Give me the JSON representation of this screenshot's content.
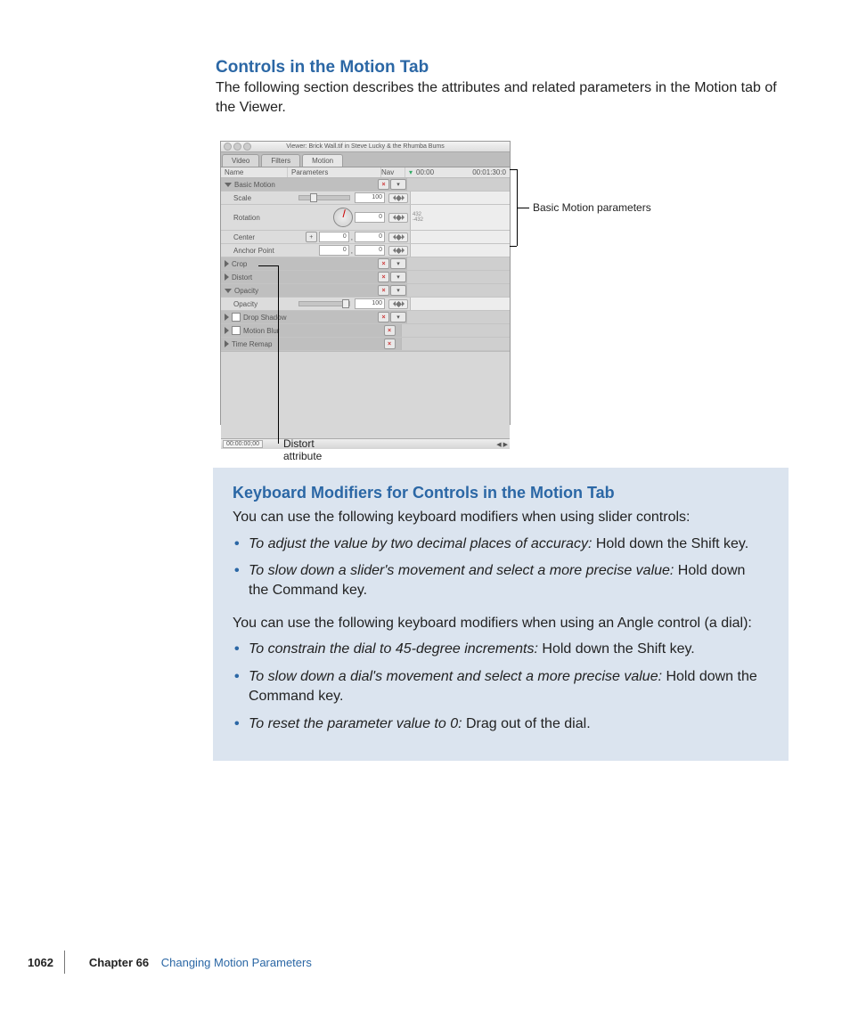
{
  "headings": {
    "controls": "Controls in the Motion Tab",
    "keyboard": "Keyboard Modifiers for Controls in the Motion Tab"
  },
  "intro": "The following section describes the attributes and related parameters in the Motion tab of the Viewer.",
  "screenshot": {
    "window_title": "Viewer: Brick Wall.tif in Steve Lucky & the Rhumba Bums",
    "tabs": {
      "video": "Video",
      "filters": "Filters",
      "motion": "Motion"
    },
    "columns": {
      "name": "Name",
      "parameters": "Parameters",
      "nav": "Nav"
    },
    "timecode_right": "00:01:30:0",
    "timecode_left": "00:00:00;00",
    "rows": {
      "basic_motion": "Basic Motion",
      "scale": "Scale",
      "scale_value": "100",
      "rotation": "Rotation",
      "rotation_value": "0",
      "rotation_track_a": "432",
      "rotation_track_b": "-432",
      "center": "Center",
      "center_x": "0",
      "center_y": "0",
      "anchor_point": "Anchor Point",
      "anchor_x": "0",
      "anchor_y": "0",
      "crop": "Crop",
      "distort": "Distort",
      "opacity_group": "Opacity",
      "opacity": "Opacity",
      "opacity_value": "100",
      "drop_shadow": "Drop Shadow",
      "motion_blur": "Motion Blur",
      "time_remap": "Time Remap"
    }
  },
  "callouts": {
    "basic_motion": "Basic Motion parameters",
    "distort": "Distort attribute"
  },
  "keyboard": {
    "intro_sliders": "You can use the following keyboard modifiers when using slider controls:",
    "slider_items": [
      {
        "em": "To adjust the value by two decimal places of accuracy:",
        "rest": "  Hold down the Shift key."
      },
      {
        "em": "To slow down a slider's movement and select a more precise value:",
        "rest": "  Hold down the Command key."
      }
    ],
    "intro_dial": "You can use the following keyboard modifiers when using an Angle control (a dial):",
    "dial_items": [
      {
        "em": "To constrain the dial to 45-degree increments:",
        "rest": "  Hold down the Shift key."
      },
      {
        "em": "To slow down a dial's movement and select a more precise value:",
        "rest": "  Hold down the Command key."
      },
      {
        "em": "To reset the parameter value to 0:",
        "rest": "  Drag out of the dial."
      }
    ]
  },
  "footer": {
    "page_number": "1062",
    "chapter_label": "Chapter 66",
    "chapter_name": "Changing Motion Parameters"
  }
}
